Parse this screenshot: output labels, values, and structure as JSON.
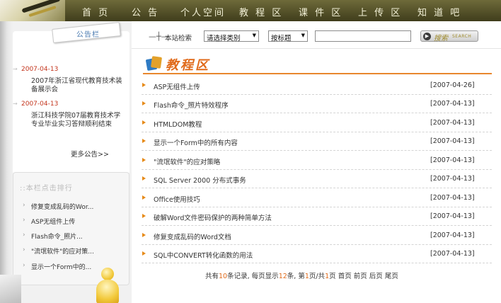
{
  "nav": {
    "items": [
      {
        "label": "首 页"
      },
      {
        "label": "公 告"
      },
      {
        "label": "个人空间"
      },
      {
        "label": "教 程 区"
      },
      {
        "label": "课 件 区"
      },
      {
        "label": "上 传 区"
      },
      {
        "label": "知 道 吧"
      }
    ]
  },
  "notices": {
    "title": "公告栏",
    "items": [
      {
        "date": "2007-04-13",
        "text": "2007年浙江省现代教育技术装备展示会"
      },
      {
        "date": "2007-04-13",
        "text": "浙江科技学院07届教育技术学专业毕业实习答辩顺利结束"
      }
    ],
    "more": "更多公告>>"
  },
  "ranking": {
    "title": "::本栏点击排行",
    "items": [
      {
        "label": "修复变成乱码的Wor..."
      },
      {
        "label": "ASP无组件上传"
      },
      {
        "label": "Flash命令_照片..."
      },
      {
        "label": "\"流氓软件\"的应对策..."
      },
      {
        "label": "显示一个Form中的..."
      }
    ]
  },
  "search": {
    "label": "本站检索",
    "category": "请选择类别",
    "field": "按标题",
    "input_value": "",
    "button_label": "搜索",
    "button_en": "SEARCH"
  },
  "section": {
    "title": "教程区"
  },
  "articles": [
    {
      "title": "ASP无组件上传",
      "date": "[2007-04-26]"
    },
    {
      "title": "Flash命令_照片特效程序",
      "date": "[2007-04-13]"
    },
    {
      "title": "HTMLDOM教程",
      "date": "[2007-04-13]"
    },
    {
      "title": "显示一个Form中的所有内容",
      "date": "[2007-04-13]"
    },
    {
      "title": "\"流氓软件\"的应对策略",
      "date": "[2007-04-13]"
    },
    {
      "title": "SQL Server 2000 分布式事务",
      "date": "[2007-04-13]"
    },
    {
      "title": "Office使用技巧",
      "date": "[2007-04-13]"
    },
    {
      "title": "破解Word文件密码保护的两种简单方法",
      "date": "[2007-04-13]"
    },
    {
      "title": "修复变成乱码的Word文档",
      "date": "[2007-04-13]"
    },
    {
      "title": "SQL中CONVERT转化函数的用法",
      "date": "[2007-04-13]"
    }
  ],
  "pager": {
    "total_prefix": "共有",
    "total": "10",
    "total_suffix": "条记录,",
    "per_page_prefix": "每页显示",
    "per_page": "12",
    "per_page_suffix": "条,",
    "page_prefix": "第",
    "current": "1",
    "page_sep": "页/共",
    "pages": "1",
    "page_suffix": "页",
    "first": "首页",
    "prev": "前页",
    "next": "后页",
    "last": "尾页"
  },
  "colors": {
    "accent": "#e06a1a",
    "nav_bg": "#4f4c27",
    "date_red": "#c3341c"
  }
}
